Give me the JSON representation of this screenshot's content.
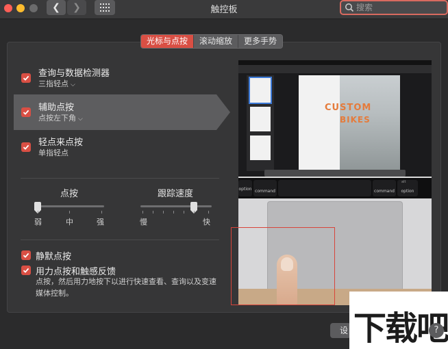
{
  "window": {
    "title": "触控板"
  },
  "search": {
    "placeholder": "搜索"
  },
  "tabs": [
    {
      "label": "光标与点按",
      "active": true
    },
    {
      "label": "滚动缩放",
      "active": false
    },
    {
      "label": "更多手势",
      "active": false
    }
  ],
  "options": {
    "lookup": {
      "label": "查询与数据检测器",
      "sub": "三指轻点",
      "checked": true
    },
    "secondary": {
      "label": "辅助点按",
      "sub": "点按左下角",
      "checked": true
    },
    "tap": {
      "label": "轻点来点按",
      "sub": "单指轻点",
      "checked": true
    },
    "silent": {
      "label": "静默点按",
      "checked": true
    },
    "force": {
      "label": "用力点按和触感反馈",
      "checked": true,
      "desc": "点按，然后用力地按下以进行快速查看、查询以及变速媒体控制。"
    }
  },
  "sliders": {
    "click": {
      "title": "点按",
      "labels": [
        "弱",
        "中",
        "强"
      ],
      "value": 0.0
    },
    "speed": {
      "title": "跟踪速度",
      "labels": [
        "慢",
        "快"
      ],
      "value": 0.75
    }
  },
  "preview": {
    "doc_line1": "CUSTOM",
    "doc_line2": "BIKES",
    "key_command": "command",
    "key_option": "option",
    "key_alt": "alt"
  },
  "footer": {
    "setup_button_partial": "设",
    "help": "?"
  },
  "watermark": {
    "text": "下载吧"
  },
  "colors": {
    "accent": "#d94f44",
    "highlight": "#5d5d5f",
    "panel": "#363637"
  }
}
